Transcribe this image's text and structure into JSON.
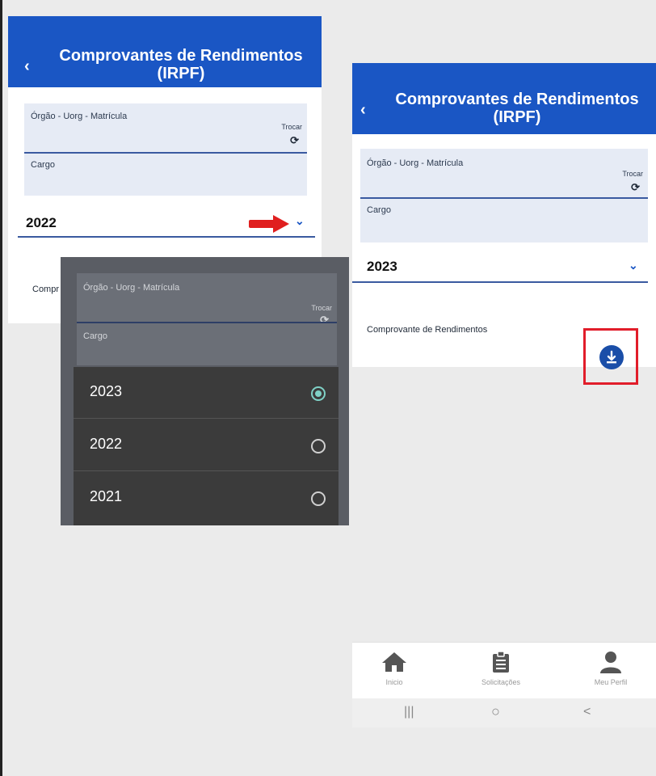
{
  "screen_title": "Comprovantes de Rendimentos (IRPF)",
  "field_org_label": "Órgão - Uorg - Matrícula",
  "field_cargo_label": "Cargo",
  "trocar_label": "Trocar",
  "comprovante_label": "Comprovante de Rendimentos",
  "comprovante_label_short": "Compr",
  "left_screen": {
    "selected_year": "2022"
  },
  "right_screen": {
    "selected_year": "2023"
  },
  "year_options": [
    {
      "label": "2023",
      "selected": true
    },
    {
      "label": "2022",
      "selected": false
    },
    {
      "label": "2021",
      "selected": false
    }
  ],
  "bottom_nav": [
    {
      "label": "Inicio",
      "icon": "home-icon"
    },
    {
      "label": "Solicitações",
      "icon": "clipboard-icon"
    },
    {
      "label": "Meu Perfil",
      "icon": "user-icon"
    }
  ],
  "system_nav": {
    "recent": "|||",
    "home": "○",
    "back": "<"
  },
  "colors": {
    "brand": "#1a56c4",
    "highlight": "#e11d2a",
    "radio_on": "#7fd1c6"
  }
}
